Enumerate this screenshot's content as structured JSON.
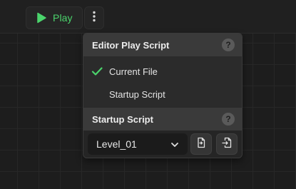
{
  "toolbar": {
    "play_label": "Play",
    "play_icon": "play-icon",
    "more_icon": "more-vertical-icon",
    "accent_color": "#4bd46c"
  },
  "menu": {
    "editor_section": {
      "title": "Editor Play Script",
      "help_glyph": "?",
      "options": [
        {
          "label": "Current File",
          "selected": true
        },
        {
          "label": "Startup Script",
          "selected": false
        }
      ]
    },
    "startup_section": {
      "title": "Startup Script",
      "help_glyph": "?",
      "selected_level": "Level_01",
      "buttons": [
        {
          "icon": "open-file-icon"
        },
        {
          "icon": "import-file-icon"
        }
      ]
    }
  }
}
